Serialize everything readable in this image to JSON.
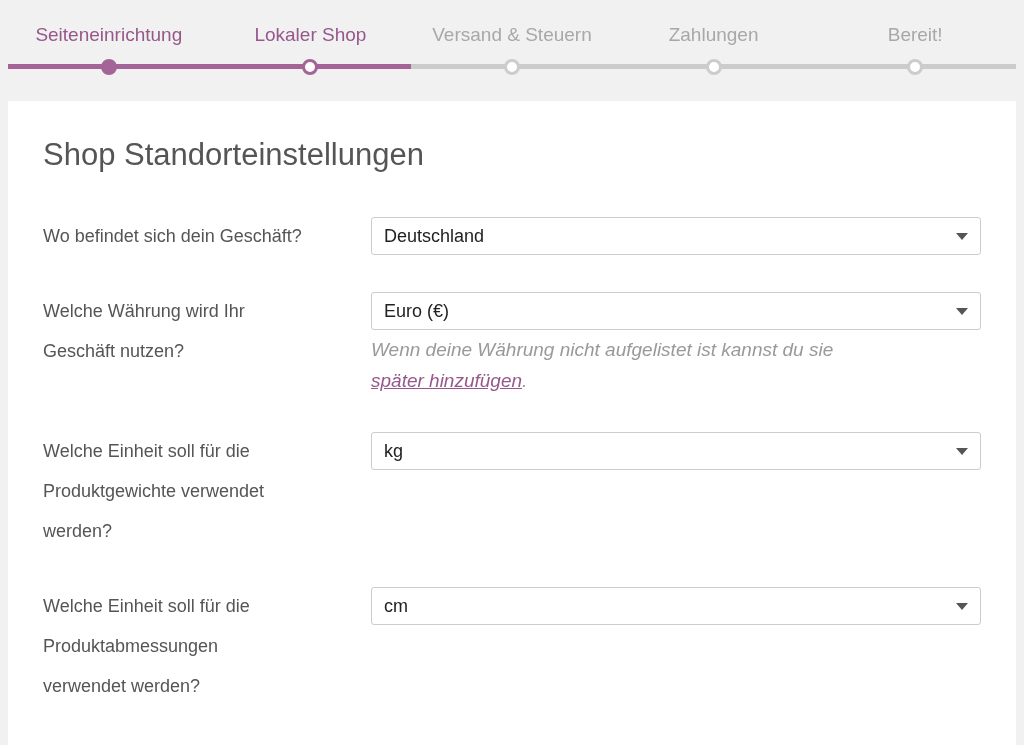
{
  "steps": [
    {
      "label": "Seiteneinrichtung",
      "completed": true,
      "selected": false
    },
    {
      "label": "Lokaler Shop",
      "completed": false,
      "selected": true
    },
    {
      "label": "Versand & Steuern",
      "completed": false,
      "selected": false
    },
    {
      "label": "Zahlungen",
      "completed": false,
      "selected": false
    },
    {
      "label": "Bereit!",
      "completed": false,
      "selected": false
    }
  ],
  "card": {
    "title": "Shop Standorteinstellungen",
    "fields": [
      {
        "label": "Wo befindet sich dein Geschäft?",
        "value": "Deutschland"
      },
      {
        "label": "Welche Währung wird Ihr Geschäft nutzen?",
        "value": "Euro (€)",
        "help": {
          "text": "Wenn deine Währung nicht aufgelistet ist kannst du sie ",
          "link": "später hinzufügen",
          "suffix": "."
        }
      },
      {
        "label": "Welche Einheit soll für die Produktgewichte verwendet werden?",
        "value": "kg"
      },
      {
        "label": "Welche Einheit soll für die Produktabmessungen verwendet werden?",
        "value": "cm"
      }
    ]
  }
}
